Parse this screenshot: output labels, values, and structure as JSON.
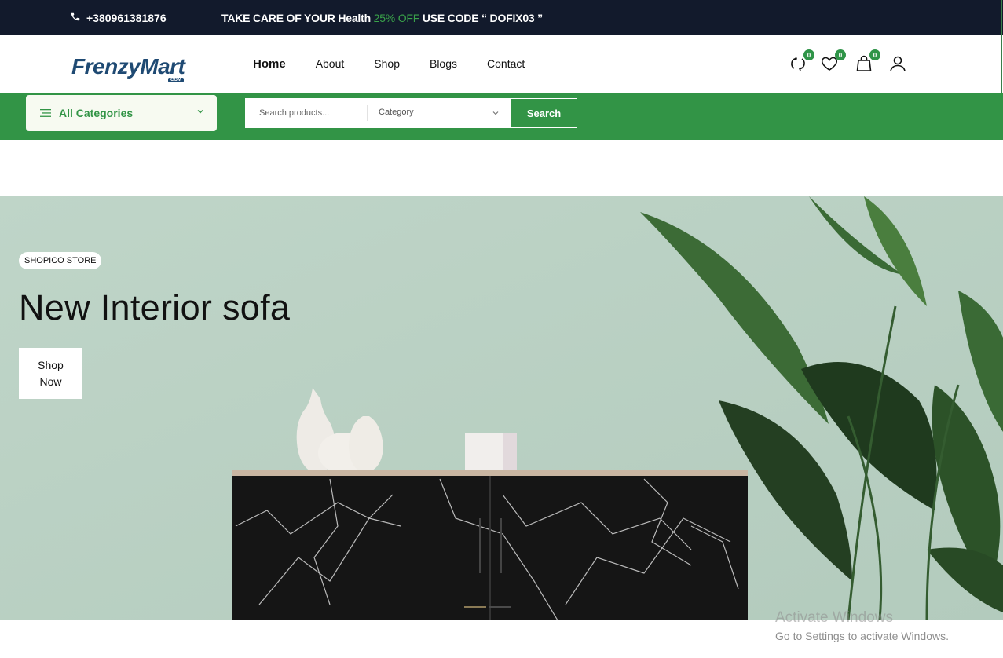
{
  "topbar": {
    "phone": "+380961381876",
    "promo_prefix": "TAKE CARE OF YOUR Health ",
    "promo_discount": "25% OFF",
    "promo_suffix": "  USE CODE “ DOFIX03 ”"
  },
  "header": {
    "logo_text": "FrenzyMart",
    "logo_sub": "COM",
    "nav": [
      "Home",
      "About",
      "Shop",
      "Blogs",
      "Contact"
    ],
    "badges": {
      "compare": "0",
      "wishlist": "0",
      "cart": "0"
    }
  },
  "searchbar": {
    "all_categories": "All Categories",
    "search_placeholder": "Search products...",
    "category_select": "Category",
    "search_button": "Search"
  },
  "hero": {
    "badge": "SHOPICO STORE",
    "title": "New Interior sofa",
    "cta_line1": "Shop",
    "cta_line2": "Now"
  },
  "watermark": {
    "line1": "Activate Windows",
    "line2": "Go to Settings to activate Windows."
  },
  "colors": {
    "topbar_bg": "#121a2c",
    "accent_green": "#329446",
    "brand_blue": "#1f4a73",
    "hero_bg": "#bcd2c6"
  }
}
